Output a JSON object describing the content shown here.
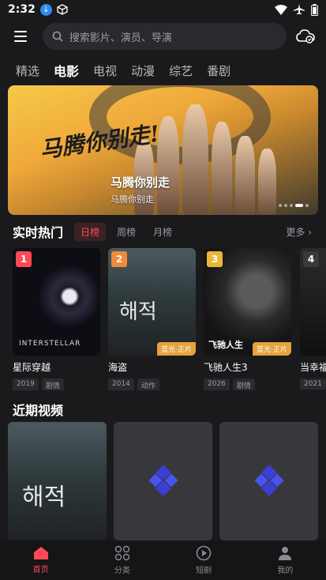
{
  "status": {
    "time": "2:32",
    "download_icon": "download-icon",
    "cube_icon": "cube-icon",
    "wifi_icon": "wifi-icon",
    "airplane_icon": "airplane-icon",
    "battery_icon": "battery-icon"
  },
  "search": {
    "placeholder": "搜索影片、演员、导演"
  },
  "categories": [
    "精选",
    "电影",
    "电视",
    "动漫",
    "综艺",
    "番剧"
  ],
  "banner": {
    "calligraphy": "马腾你别走!",
    "title": "马腾你别走",
    "subtitle": "马腾你别走"
  },
  "hot": {
    "title": "实时热门",
    "filters": [
      "日榜",
      "周榜",
      "月榜"
    ],
    "more": "更多",
    "items": [
      {
        "rank": "1",
        "name": "星际穿越",
        "year": "2019",
        "genre": "剧情",
        "badge": "",
        "rank_color": "#ff4a55"
      },
      {
        "rank": "2",
        "name": "海盗",
        "year": "2014",
        "genre": "动作",
        "badge": "蓝光·正片",
        "rank_color": "#f08b3a"
      },
      {
        "rank": "3",
        "name": "飞驰人生3",
        "year": "2026",
        "genre": "剧情",
        "badge": "蓝光·正片",
        "rank_color": "#e9b83a"
      },
      {
        "rank": "4",
        "name": "当幸福",
        "year": "2021",
        "genre": "",
        "badge": "",
        "rank_color": "#6c6c70"
      }
    ]
  },
  "recent": {
    "title": "近期视频"
  },
  "nav": [
    {
      "label": "首页",
      "icon": "home-icon"
    },
    {
      "label": "分类",
      "icon": "grid-icon"
    },
    {
      "label": "短剧",
      "icon": "play-circle-icon"
    },
    {
      "label": "我的",
      "icon": "user-icon"
    }
  ],
  "colors": {
    "accent": "#ff4a55",
    "background": "#1a1a1c",
    "badge": "#e4a33c"
  }
}
